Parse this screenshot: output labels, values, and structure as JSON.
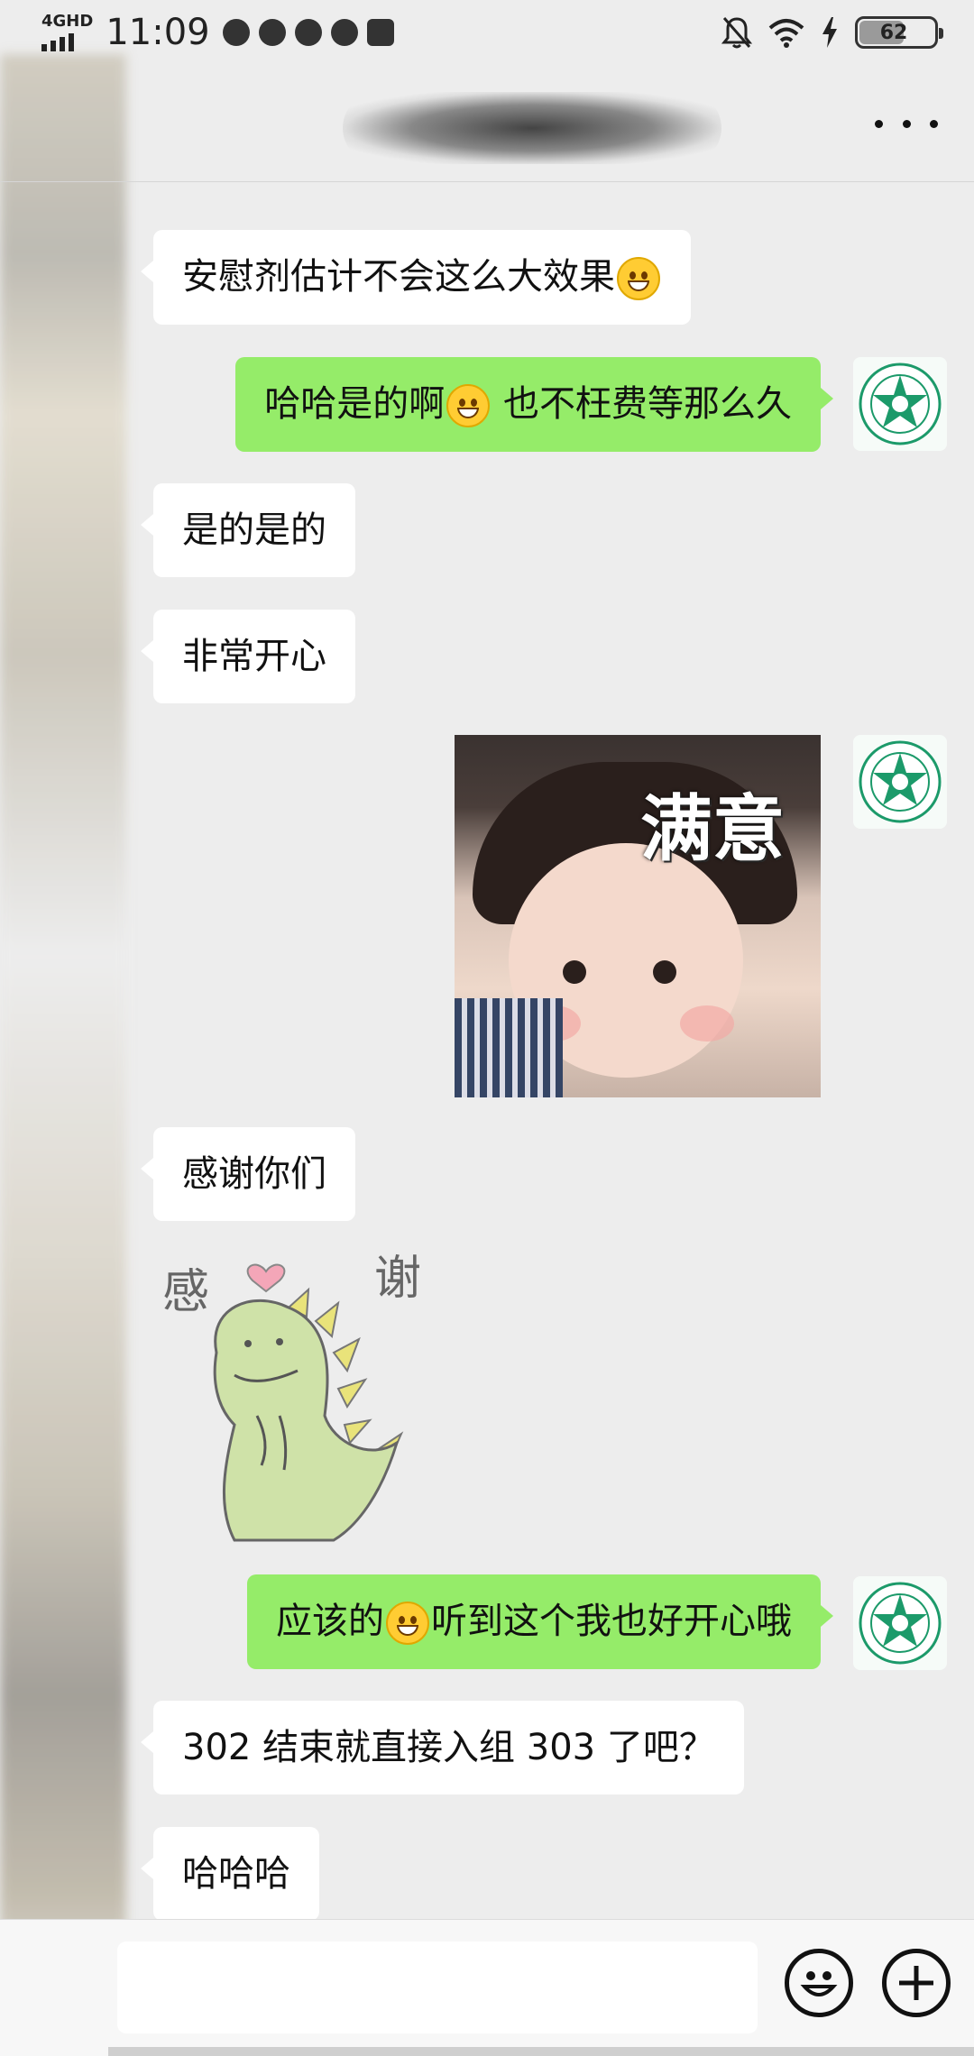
{
  "status_bar": {
    "network": "4GHD",
    "time": "11:09",
    "battery": "62",
    "battery_level": 0.62
  },
  "header": {
    "title": "安",
    "more_icon": "more-dots-icon"
  },
  "messages": [
    {
      "side": "in",
      "type": "text",
      "parts": [
        "安慰剂估计不会这么大效果"
      ],
      "emoji": "laugh-cry-emoji"
    },
    {
      "side": "out",
      "type": "text",
      "before": "哈哈是的啊",
      "after": " 也不枉费等那么久",
      "emoji": "grin-emoji"
    },
    {
      "side": "in",
      "type": "text",
      "text": "是的是的"
    },
    {
      "side": "in",
      "type": "text",
      "text": "非常开心"
    },
    {
      "side": "out",
      "type": "image",
      "caption": "满意"
    },
    {
      "side": "in",
      "type": "text",
      "text": "感谢你们"
    },
    {
      "side": "in",
      "type": "sticker",
      "left_text": "感",
      "right_text": "谢"
    },
    {
      "side": "out",
      "type": "text",
      "before": "应该的",
      "after": "听到这个我也好开心哦",
      "emoji": "grin-emoji"
    },
    {
      "side": "in",
      "type": "text",
      "text": "302 结束就直接入组 303 了吧？"
    },
    {
      "side": "in",
      "type": "text",
      "text": "哈哈哈"
    }
  ],
  "input_bar": {
    "placeholder": "",
    "emoji_button": "smiley-icon",
    "plus_button": "plus-icon"
  },
  "colors": {
    "background": "#ededed",
    "outgoing_bubble": "#95ec69",
    "incoming_bubble": "#ffffff"
  }
}
